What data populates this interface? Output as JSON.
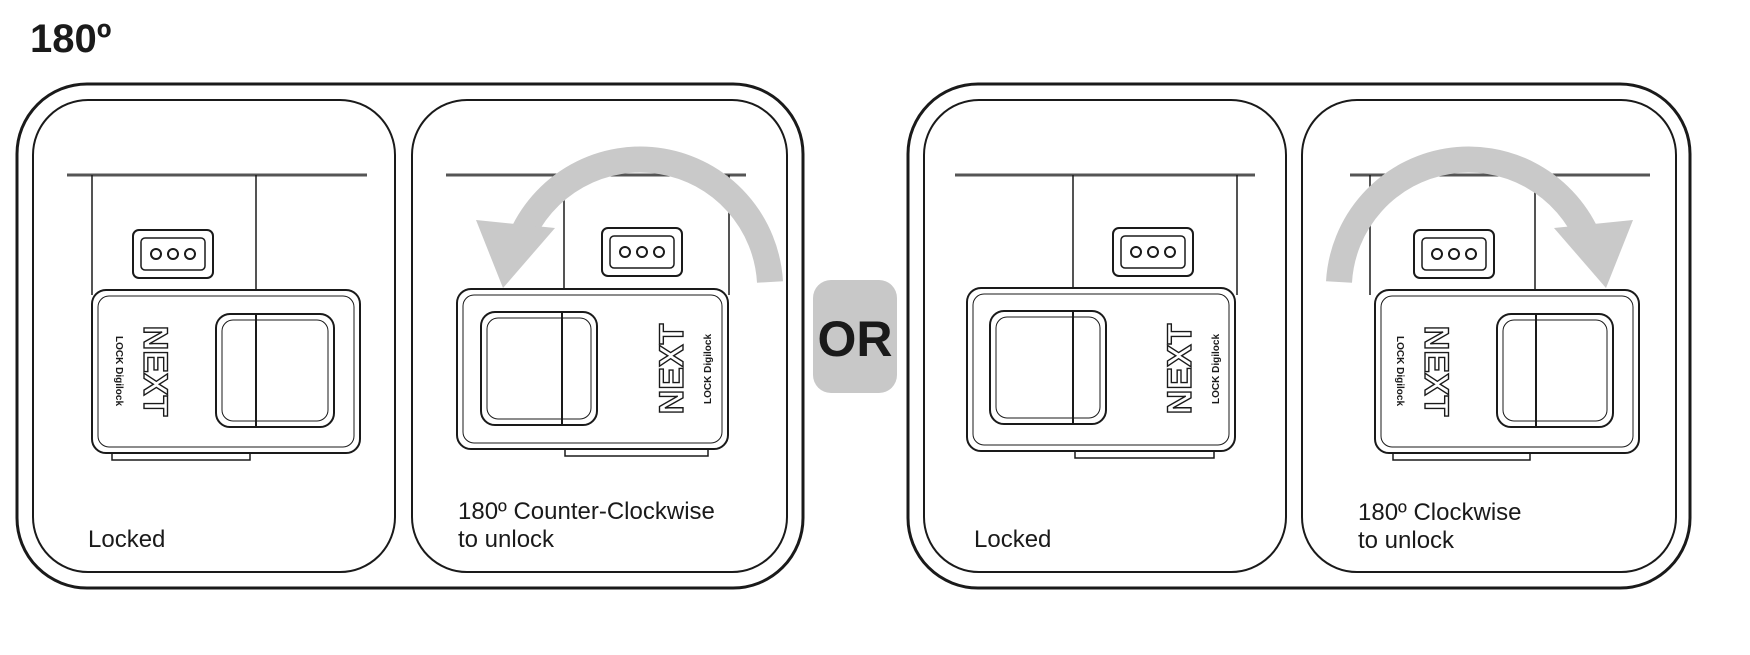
{
  "heading": {
    "angle_label": "180º"
  },
  "divider": {
    "or_label": "OR"
  },
  "groups": [
    {
      "locked": {
        "caption": "Locked"
      },
      "unlock": {
        "caption_line1": "180º Counter-Clockwise",
        "caption_line2": "to unlock",
        "arrow_direction": "counter-clockwise"
      }
    },
    {
      "locked": {
        "caption": "Locked"
      },
      "unlock": {
        "caption_line1": "180º Clockwise",
        "caption_line2": "to unlock",
        "arrow_direction": "clockwise"
      }
    }
  ],
  "brand": {
    "logo_text": "NEXT",
    "logo_subtext": "LOCK  Digilock"
  },
  "colors": {
    "outline": "#1a1a1a",
    "arrow": "#c9c9c9",
    "or_badge": "#c8c8c8",
    "background": "#ffffff"
  },
  "icons": {
    "rotation_arrow": "curved-arrow-icon",
    "keypad": "three-dot-strike-icon"
  }
}
